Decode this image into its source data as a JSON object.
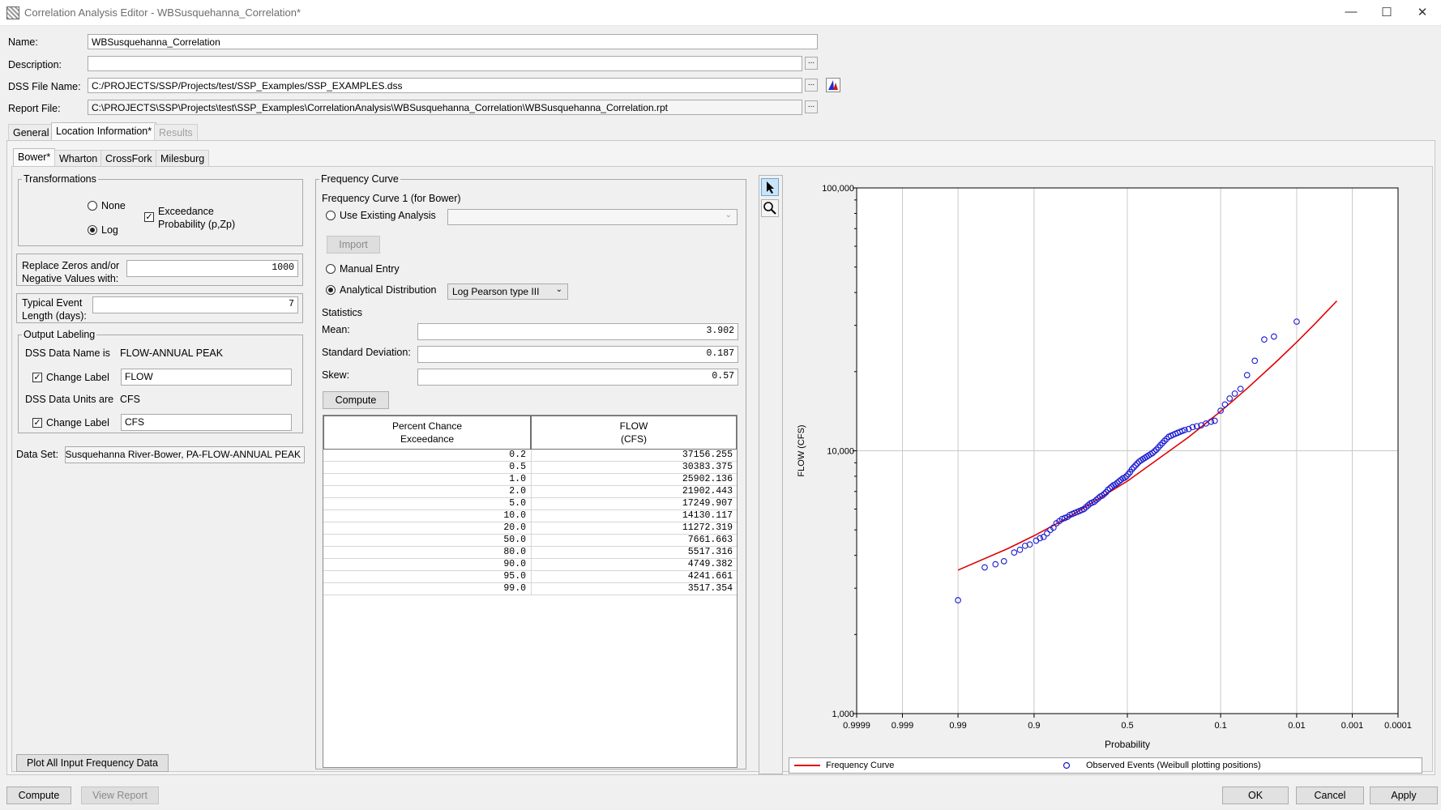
{
  "window": {
    "title": "Correlation Analysis Editor - WBSusquehanna_Correlation*"
  },
  "fields": {
    "name_label": "Name:",
    "name_value": "WBSusquehanna_Correlation",
    "description_label": "Description:",
    "description_value": "",
    "dss_label": "DSS File Name:",
    "dss_value": "C:/PROJECTS/SSP/Projects/test/SSP_Examples/SSP_EXAMPLES.dss",
    "report_label": "Report File:",
    "report_value": "C:\\PROJECTS\\SSP\\Projects\\test\\SSP_Examples\\CorrelationAnalysis\\WBSusquehanna_Correlation\\WBSusquehanna_Correlation.rpt",
    "browse": "..."
  },
  "tabs": [
    "General",
    "Location Information*",
    "Results"
  ],
  "location_tabs": [
    "Bower*",
    "Wharton",
    "CrossFork",
    "Milesburg"
  ],
  "transformations": {
    "title": "Transformations",
    "none": "None",
    "log": "Log",
    "exceedance_line1": "Exceedance",
    "exceedance_line2": "Probability (p,Zp)"
  },
  "replace_zeros": {
    "line1": "Replace Zeros and/or",
    "line2": "Negative Values with:",
    "value": "1000"
  },
  "typical_event": {
    "line1": "Typical Event",
    "line2": "Length (days):",
    "value": "7"
  },
  "output_labeling": {
    "title": "Output Labeling",
    "dss_name_label": "DSS Data Name is",
    "dss_name_value": "FLOW-ANNUAL PEAK",
    "change_label": "Change Label",
    "name_field": "FLOW",
    "dss_units_label": "DSS Data Units are",
    "dss_units_value": "CFS",
    "units_field": "CFS"
  },
  "data_set": {
    "label": "Data Set:",
    "value": "Susquehanna River-Bower, PA-FLOW-ANNUAL PEAK"
  },
  "plot_all_button": "Plot All Input Frequency Data",
  "frequency_curve": {
    "title": "Frequency Curve",
    "subtitle": "Frequency Curve 1 (for Bower)",
    "use_existing": "Use Existing Analysis",
    "import_button": "Import",
    "manual_entry": "Manual Entry",
    "analytical": "Analytical Distribution",
    "distribution": "Log Pearson type III",
    "statistics_title": "Statistics",
    "mean_label": "Mean:",
    "mean_value": "3.902",
    "sd_label": "Standard Deviation:",
    "sd_value": "0.187",
    "skew_label": "Skew:",
    "skew_value": "0.57",
    "compute_button": "Compute"
  },
  "table": {
    "col1_line1": "Percent Chance",
    "col1_line2": "Exceedance",
    "col2_line1": "FLOW",
    "col2_line2": "(CFS)",
    "rows": [
      [
        "0.2",
        "37156.255"
      ],
      [
        "0.5",
        "30383.375"
      ],
      [
        "1.0",
        "25902.136"
      ],
      [
        "2.0",
        "21902.443"
      ],
      [
        "5.0",
        "17249.907"
      ],
      [
        "10.0",
        "14130.117"
      ],
      [
        "20.0",
        "11272.319"
      ],
      [
        "50.0",
        "7661.663"
      ],
      [
        "80.0",
        "5517.316"
      ],
      [
        "90.0",
        "4749.382"
      ],
      [
        "95.0",
        "4241.661"
      ],
      [
        "99.0",
        "3517.354"
      ]
    ]
  },
  "chart_data": {
    "type": "scatter",
    "title": "",
    "xlabel": "Probability",
    "ylabel": "FLOW (CFS)",
    "x_scale": "probability (normal)",
    "y_scale": "log",
    "ylim": [
      1000,
      100000
    ],
    "x_ticks": [
      "0.9999",
      "0.999",
      "0.99",
      "0.9",
      "0.5",
      "0.1",
      "0.01",
      "0.001",
      "0.0001"
    ],
    "y_ticks": [
      "1,000",
      "10,000",
      "100,000"
    ],
    "grid": true,
    "legend_position": "bottom",
    "series": [
      {
        "name": "Frequency Curve",
        "type": "line",
        "color": "#e00000",
        "points": [
          [
            0.99,
            3517.354
          ],
          [
            0.95,
            4241.661
          ],
          [
            0.9,
            4749.382
          ],
          [
            0.8,
            5517.316
          ],
          [
            0.5,
            7661.663
          ],
          [
            0.2,
            11272.319
          ],
          [
            0.1,
            14130.117
          ],
          [
            0.05,
            17249.907
          ],
          [
            0.02,
            21902.443
          ],
          [
            0.01,
            25902.136
          ],
          [
            0.005,
            30383.375
          ],
          [
            0.002,
            37156.255
          ]
        ]
      },
      {
        "name": "Observed Events (Weibull plotting positions)",
        "type": "scatter",
        "color": "#1a1ad0",
        "points": [
          [
            0.99,
            2700
          ],
          [
            0.975,
            3600
          ],
          [
            0.965,
            3700
          ],
          [
            0.955,
            3800
          ],
          [
            0.94,
            4100
          ],
          [
            0.93,
            4200
          ],
          [
            0.92,
            4350
          ],
          [
            0.91,
            4400
          ],
          [
            0.895,
            4550
          ],
          [
            0.885,
            4650
          ],
          [
            0.875,
            4700
          ],
          [
            0.865,
            4850
          ],
          [
            0.855,
            5000
          ],
          [
            0.845,
            5100
          ],
          [
            0.835,
            5300
          ],
          [
            0.825,
            5400
          ],
          [
            0.815,
            5500
          ],
          [
            0.805,
            5550
          ],
          [
            0.795,
            5600
          ],
          [
            0.785,
            5700
          ],
          [
            0.775,
            5750
          ],
          [
            0.765,
            5800
          ],
          [
            0.755,
            5850
          ],
          [
            0.745,
            5900
          ],
          [
            0.735,
            5950
          ],
          [
            0.725,
            6000
          ],
          [
            0.715,
            6100
          ],
          [
            0.705,
            6200
          ],
          [
            0.695,
            6300
          ],
          [
            0.685,
            6350
          ],
          [
            0.675,
            6400
          ],
          [
            0.665,
            6500
          ],
          [
            0.655,
            6600
          ],
          [
            0.645,
            6700
          ],
          [
            0.635,
            6750
          ],
          [
            0.625,
            6850
          ],
          [
            0.615,
            6950
          ],
          [
            0.605,
            7100
          ],
          [
            0.595,
            7200
          ],
          [
            0.585,
            7300
          ],
          [
            0.575,
            7400
          ],
          [
            0.565,
            7450
          ],
          [
            0.555,
            7550
          ],
          [
            0.545,
            7650
          ],
          [
            0.535,
            7750
          ],
          [
            0.525,
            7850
          ],
          [
            0.515,
            7900
          ],
          [
            0.505,
            8000
          ],
          [
            0.495,
            8150
          ],
          [
            0.485,
            8300
          ],
          [
            0.475,
            8500
          ],
          [
            0.465,
            8650
          ],
          [
            0.455,
            8800
          ],
          [
            0.445,
            8950
          ],
          [
            0.435,
            9100
          ],
          [
            0.425,
            9200
          ],
          [
            0.415,
            9300
          ],
          [
            0.405,
            9400
          ],
          [
            0.395,
            9500
          ],
          [
            0.385,
            9600
          ],
          [
            0.375,
            9700
          ],
          [
            0.365,
            9800
          ],
          [
            0.355,
            9950
          ],
          [
            0.345,
            10100
          ],
          [
            0.335,
            10300
          ],
          [
            0.325,
            10500
          ],
          [
            0.315,
            10700
          ],
          [
            0.305,
            10900
          ],
          [
            0.295,
            11100
          ],
          [
            0.285,
            11300
          ],
          [
            0.275,
            11400
          ],
          [
            0.265,
            11500
          ],
          [
            0.255,
            11600
          ],
          [
            0.245,
            11700
          ],
          [
            0.235,
            11800
          ],
          [
            0.225,
            11900
          ],
          [
            0.215,
            12000
          ],
          [
            0.2,
            12100
          ],
          [
            0.185,
            12300
          ],
          [
            0.17,
            12400
          ],
          [
            0.155,
            12500
          ],
          [
            0.14,
            12700
          ],
          [
            0.125,
            12900
          ],
          [
            0.115,
            13000
          ],
          [
            0.1,
            14200
          ],
          [
            0.09,
            15000
          ],
          [
            0.08,
            15800
          ],
          [
            0.07,
            16500
          ],
          [
            0.06,
            17200
          ],
          [
            0.05,
            19400
          ],
          [
            0.04,
            22000
          ],
          [
            0.03,
            26500
          ],
          [
            0.022,
            27200
          ],
          [
            0.01,
            31000
          ]
        ]
      }
    ]
  },
  "legend": {
    "curve": "Frequency Curve",
    "observed": "Observed Events (Weibull plotting positions)"
  },
  "bottom_buttons": {
    "compute": "Compute",
    "view_report": "View Report",
    "ok": "OK",
    "cancel": "Cancel",
    "apply": "Apply"
  },
  "colors": {
    "curve": "#e00000",
    "observed": "#1a1ad0",
    "selection": "#cce4f7"
  }
}
